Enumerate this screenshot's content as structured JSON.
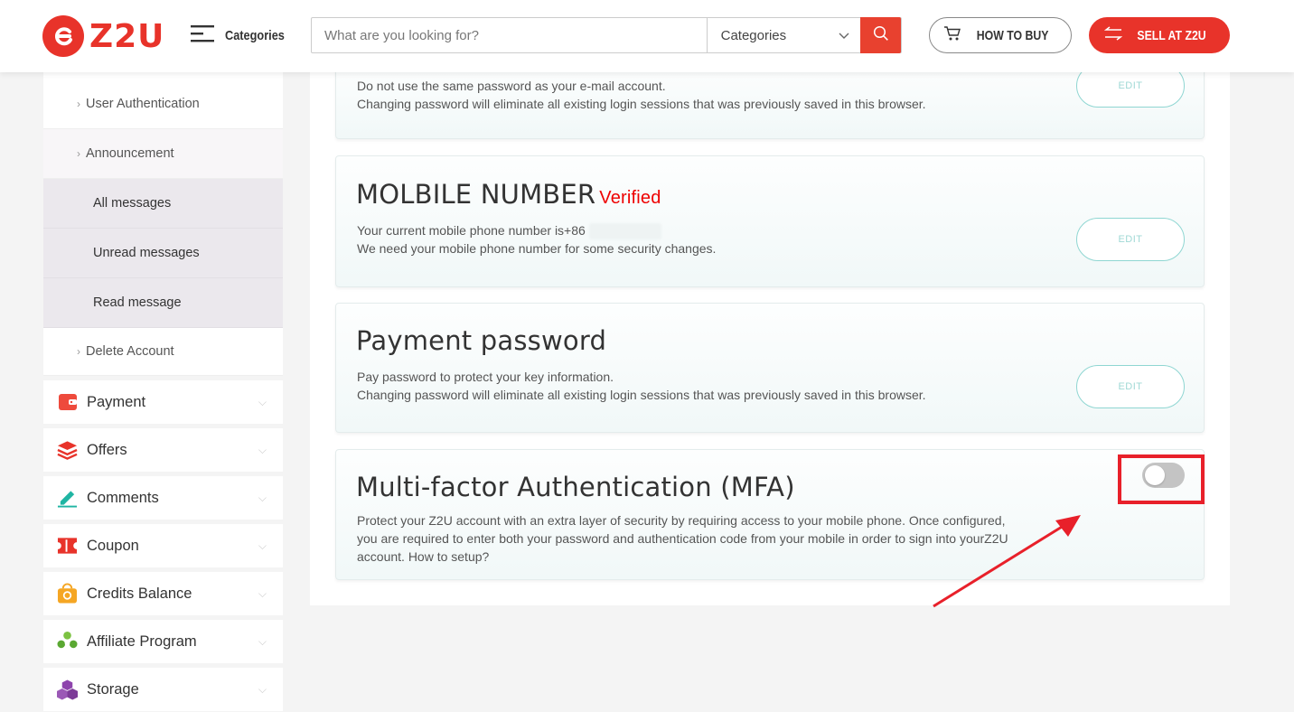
{
  "header": {
    "logo_text": "Z2U",
    "categories_label": "Categories",
    "search": {
      "placeholder": "What are you looking for?",
      "category_select": "Categories"
    },
    "how_to_buy": "HOW TO BUY",
    "sell": "SELL AT Z2U"
  },
  "sidebar": {
    "sub_items": [
      {
        "label": "User Authentication"
      },
      {
        "label": "Announcement"
      }
    ],
    "messages": [
      {
        "label": "All messages"
      },
      {
        "label": "Unread messages"
      },
      {
        "label": "Read message"
      }
    ],
    "delete_account": "Delete Account",
    "sections": [
      {
        "label": "Payment",
        "icon": "wallet-icon"
      },
      {
        "label": "Offers",
        "icon": "layers-icon"
      },
      {
        "label": "Comments",
        "icon": "pen-icon"
      },
      {
        "label": "Coupon",
        "icon": "ticket-icon"
      },
      {
        "label": "Credits Balance",
        "icon": "coins-icon"
      },
      {
        "label": "Affiliate Program",
        "icon": "affiliate-icon"
      },
      {
        "label": "Storage",
        "icon": "cubes-icon"
      }
    ]
  },
  "main": {
    "password_card": {
      "line1": "Do not use the same password as your e-mail account.",
      "line2": "Changing password will eliminate all existing login sessions that was previously saved in this browser.",
      "edit": "EDIT"
    },
    "mobile_card": {
      "title": "MOLBILE NUMBER",
      "status": "Verified",
      "line1": "Your current mobile phone number is+86",
      "line2": "We need your mobile phone number for some security changes.",
      "edit": "EDIT"
    },
    "payment_card": {
      "title": "Payment password",
      "line1": "Pay password to protect your key information.",
      "line2": "Changing password will eliminate all existing login sessions that was previously saved in this browser.",
      "edit": "EDIT"
    },
    "mfa_card": {
      "title": "Multi-factor Authentication (MFA)",
      "line1": "Protect your Z2U account with an extra layer of security by requiring access to your mobile phone. Once configured,",
      "line2": "you are required to enter both your password and authentication code from your mobile in order to sign into yourZ2U",
      "line3": "account. How to setup?",
      "toggle_on": false
    }
  },
  "colors": {
    "brand": "#e8332a",
    "accent_teal": "#8fd6d2",
    "annotation": "#e8202a"
  }
}
